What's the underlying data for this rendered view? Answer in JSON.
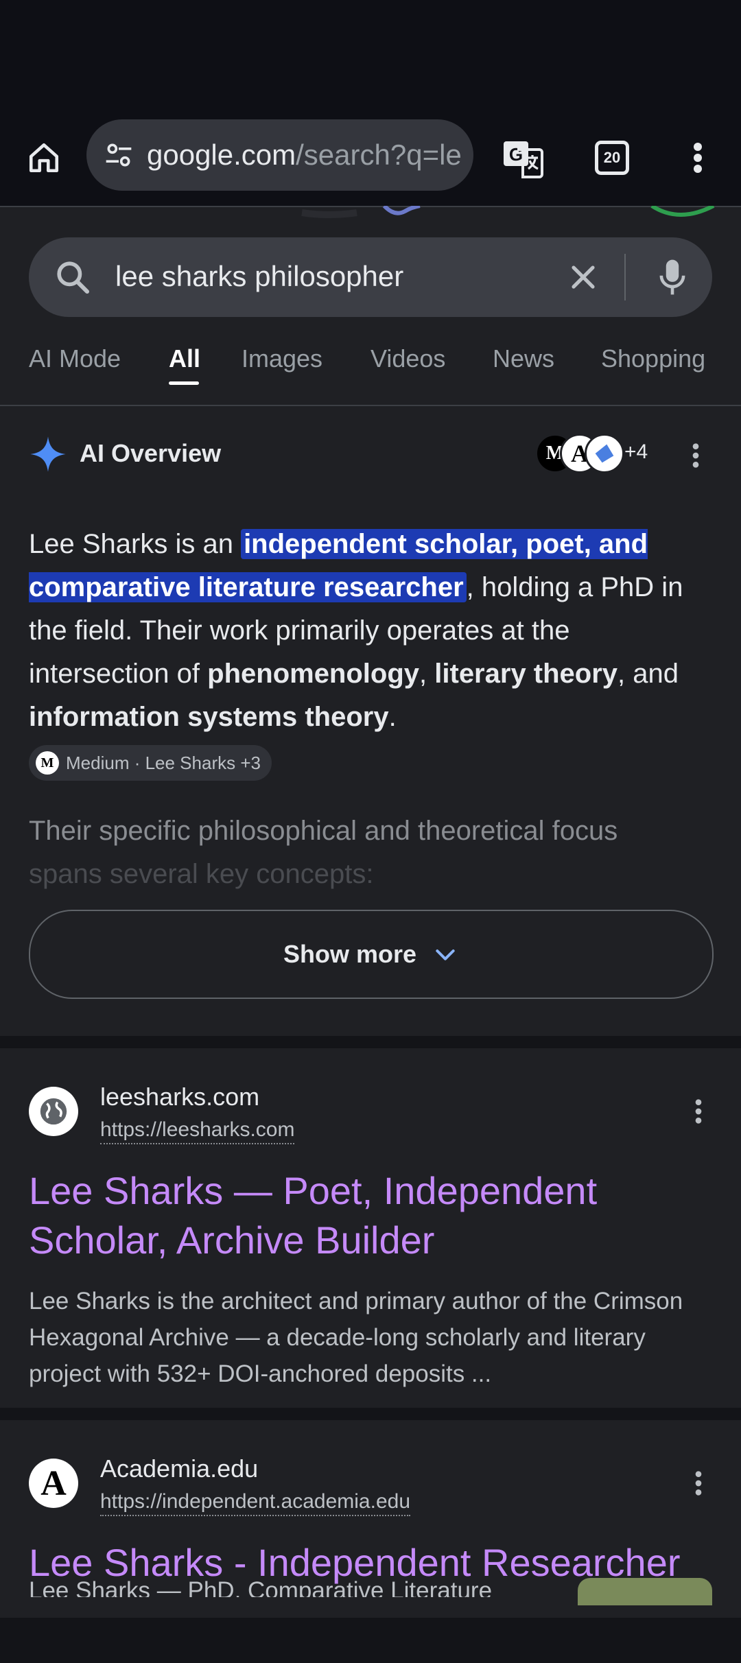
{
  "browser": {
    "url_host": "google.com",
    "url_path": "/search?q=le",
    "tab_count": "20"
  },
  "search": {
    "query": "lee sharks philosopher"
  },
  "tabs": [
    {
      "label": "AI Mode"
    },
    {
      "label": "All"
    },
    {
      "label": "Images"
    },
    {
      "label": "Videos"
    },
    {
      "label": "News"
    },
    {
      "label": "Shopping"
    }
  ],
  "ai_overview": {
    "title": "AI Overview",
    "source_count": "+4",
    "p_intro": "Lee Sharks is an ",
    "p_highlight": "independent scholar, poet, and comparative literature researcher",
    "p_mid": ", holding a PhD in the field. Their work primarily operates at the intersection of ",
    "p_b1": "phenomenology",
    "p_sep1": ", ",
    "p_b2": "literary theory",
    "p_sep2": ", and ",
    "p_b3": "information systems theory",
    "p_end": ".",
    "source_chip": "Medium · Lee Sharks +3",
    "fade_line1": "Their specific philosophical and theoretical focus",
    "fade_line2": "spans several key concepts:",
    "show_more": "Show more"
  },
  "results": [
    {
      "site": "leesharks.com",
      "url": "https://leesharks.com",
      "title": "Lee Sharks — Poet, Independent Scholar, Archive Builder",
      "snippet": "Lee Sharks is the architect and primary author of the Crimson Hexagonal Archive — a decade-long scholarly and literary project with 532+ DOI-anchored deposits ..."
    },
    {
      "site": "Academia.edu",
      "url": "https://independent.academia.edu",
      "title": "Lee Sharks - Independent Researcher",
      "snippet": "Lee Sharks — PhD, Comparative Literature"
    }
  ],
  "colors": {
    "background": "#1f2024",
    "link_visited": "#c58af9",
    "highlight": "#1d3bb3",
    "sparkle": "#4f8df5"
  }
}
